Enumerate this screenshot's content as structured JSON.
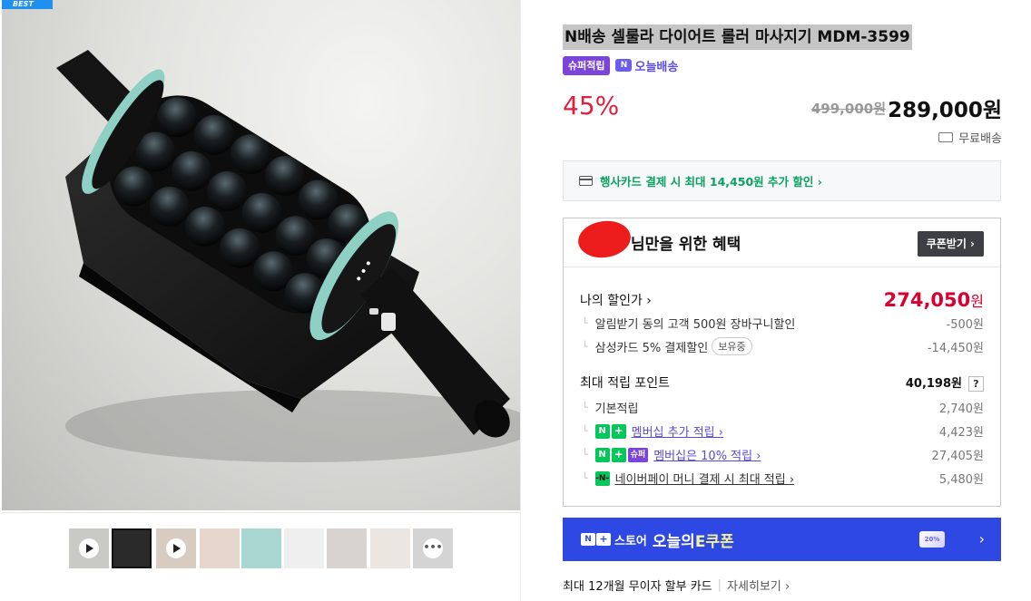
{
  "gallery": {
    "badge": "BEST",
    "thumbnails": [
      {
        "kind": "video",
        "icon": "play-icon"
      },
      {
        "kind": "image",
        "selected": true
      },
      {
        "kind": "video",
        "icon": "play-icon"
      },
      {
        "kind": "image"
      },
      {
        "kind": "image"
      },
      {
        "kind": "image"
      },
      {
        "kind": "image"
      },
      {
        "kind": "image"
      },
      {
        "kind": "image"
      },
      {
        "kind": "more",
        "label": "•••"
      }
    ]
  },
  "product": {
    "title": "N배송 셀룰라 다이어트 롤러 마사지기 MDM-3599",
    "super_tag": "슈퍼적립",
    "today_icon": "N",
    "today_label": "오늘배송",
    "discount": "45%",
    "original_price": "499,000원",
    "sale_price": "289,000",
    "sale_unit": "원",
    "shipping": "무료배송"
  },
  "card_promo": {
    "text": "행사카드 결제 시 최대 14,450원 추가 할인 ›"
  },
  "benefit": {
    "title": "님만을 위한 혜택",
    "coupon_button": "쿠폰받기 ›",
    "my_price_label": "나의 할인가 ›",
    "my_price": "274,050",
    "my_price_unit": "원",
    "discounts": [
      {
        "label": "알림받기 동의 고객 500원 장바구니할인",
        "value": "-500원"
      },
      {
        "label": "삼성카드 5% 결제할인",
        "pill": "보유중",
        "value": "-14,450원"
      }
    ],
    "points_label": "최대 적립 포인트",
    "points_value": "40,198원",
    "points_help": "?",
    "points": [
      {
        "label": "기본적립",
        "value": "2,740원"
      },
      {
        "label": "멤버십 추가 적립 ›",
        "value": "4,423원"
      },
      {
        "label": "멤버십은 10% 적립 ›",
        "super": "슈퍼",
        "value": "27,405원"
      },
      {
        "label": "네이버페이 머니 결제 시 최대 적립 ›",
        "value": "5,480원"
      }
    ]
  },
  "ecoupon": {
    "n": "N",
    "plus": "+",
    "store": "스토어",
    "today": "오늘의",
    "e": "E쿠폰",
    "ticket": "20%",
    "chevron": "›"
  },
  "installment": {
    "text": "최대 12개월 무이자 할부 카드",
    "sep": "|",
    "detail": "자세히보기 ›"
  },
  "colors": {
    "discount_red": "#e0203c",
    "my_price_red": "#d8002f",
    "naver_green": "#03c75a",
    "super_purple": "#7b45d9",
    "ecoupon_blue": "#2e48e3"
  }
}
